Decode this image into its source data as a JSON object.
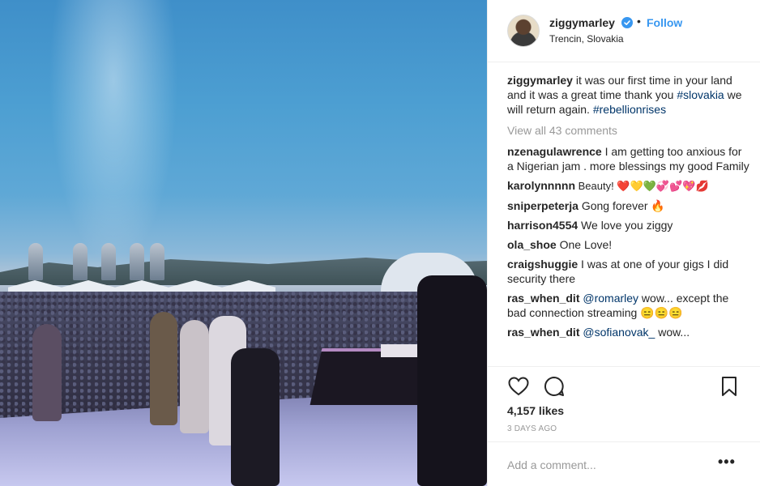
{
  "post": {
    "username": "ziggymarley",
    "follow_label": "Follow",
    "location": "Trencin, Slovakia",
    "caption": {
      "user": "ziggymarley",
      "text": " it was our first time in your land and it was a great time thank you ",
      "tag1": "#slovakia",
      "text2": " we will return again. ",
      "tag2": "#rebellionrises"
    },
    "view_all": "View all 43 comments",
    "comments": [
      {
        "user": "nzenagulawrence",
        "text": " I am getting too anxious for a Nigerian jam . more blessings my good Family"
      },
      {
        "user": "karolynnnnn",
        "text": " Beauty! ❤️💛💚💞💕💖💋"
      },
      {
        "user": "sniperpeterja",
        "text": " Gong forever 🔥"
      },
      {
        "user": "harrison4554",
        "text": " We love you ziggy"
      },
      {
        "user": "ola_shoe",
        "text": " One Love!"
      },
      {
        "user": "craigshuggie",
        "text": " I was at one of your gigs I did security there"
      },
      {
        "user": "ras_when_dit",
        "mention": "@romarley",
        "text": " wow... except the bad connection streaming 😑😑😑"
      },
      {
        "user": "ras_when_dit",
        "mention": "@sofianovak_",
        "text": " wow..."
      }
    ],
    "likes": "4,157 likes",
    "time_ago": "3 DAYS AGO",
    "add_comment_placeholder": "Add a comment...",
    "more_label": "•••"
  },
  "icons": {
    "verified": "verified-badge-icon",
    "like": "heart-icon",
    "comment": "comment-bubble-icon",
    "save": "bookmark-icon"
  },
  "colors": {
    "link": "#3897f0",
    "hashtag": "#003569",
    "muted": "#999999",
    "text": "#262626"
  }
}
